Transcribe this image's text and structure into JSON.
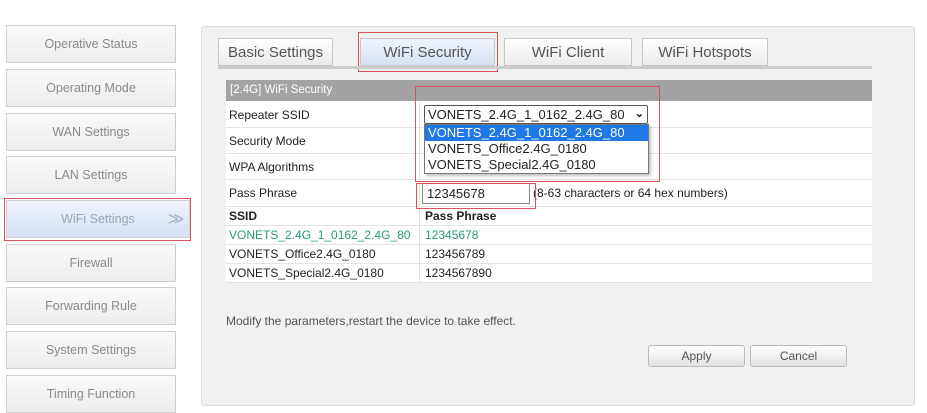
{
  "sidebar": {
    "items": [
      {
        "label": "Operative Status"
      },
      {
        "label": "Operating Mode"
      },
      {
        "label": "WAN Settings"
      },
      {
        "label": "LAN Settings"
      },
      {
        "label": "WiFi Settings"
      },
      {
        "label": "Firewall"
      },
      {
        "label": "Forwarding Rule"
      },
      {
        "label": "System Settings"
      },
      {
        "label": "Timing Function"
      }
    ],
    "active_chevron": ">>"
  },
  "tabs": [
    {
      "label": "Basic Settings"
    },
    {
      "label": "WiFi Security"
    },
    {
      "label": "WiFi Client"
    },
    {
      "label": "WiFi Hotspots"
    }
  ],
  "section_title": "[2.4G] WiFi Security",
  "form": {
    "repeater_ssid_label": "Repeater SSID",
    "repeater_ssid_value": "VONETS_2.4G_1_0162_2.4G_80",
    "options": [
      "VONETS_2.4G_1_0162_2.4G_80",
      "VONETS_Office2.4G_0180",
      "VONETS_Special2.4G_0180"
    ],
    "security_mode_label": "Security Mode",
    "wpa_label": "WPA Algorithms",
    "pass_label": "Pass Phrase",
    "pass_value": "12345678",
    "pass_hint": "(8-63 characters or 64 hex numbers)"
  },
  "list": {
    "headers": [
      "SSID",
      "Pass Phrase"
    ],
    "rows": [
      [
        "VONETS_2.4G_1_0162_2.4G_80",
        "12345678"
      ],
      [
        "VONETS_Office2.4G_0180",
        "123456789"
      ],
      [
        "VONETS_Special2.4G_0180",
        "1234567890"
      ]
    ]
  },
  "message": "Modify the parameters,restart the device to take effect.",
  "buttons": {
    "apply": "Apply",
    "cancel": "Cancel"
  },
  "colors": {
    "highlight": "#d9535f",
    "selected_option": "#1e78e6",
    "active_row": "#2a9a7a"
  }
}
